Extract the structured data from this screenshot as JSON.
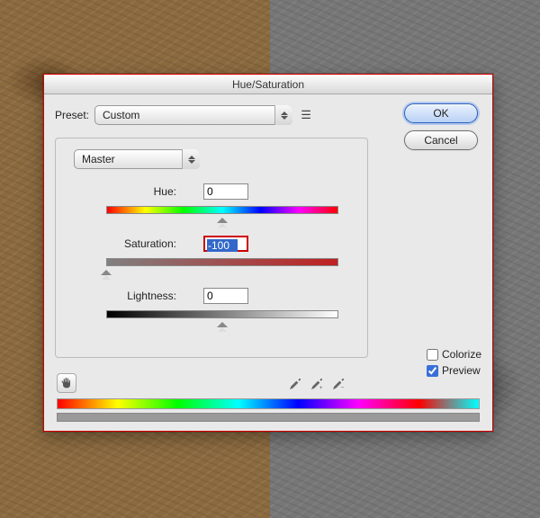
{
  "dialog": {
    "title": "Hue/Saturation",
    "preset_label": "Preset:",
    "preset_value": "Custom",
    "channel_value": "Master",
    "buttons": {
      "ok": "OK",
      "cancel": "Cancel"
    },
    "params": {
      "hue": {
        "label": "Hue:",
        "value": "0",
        "handle": 0.5
      },
      "saturation": {
        "label": "Saturation:",
        "value": "-100",
        "handle": 0.0
      },
      "lightness": {
        "label": "Lightness:",
        "value": "0",
        "handle": 0.5
      }
    },
    "checks": {
      "colorize": {
        "label": "Colorize",
        "checked": false
      },
      "preview": {
        "label": "Preview",
        "checked": true
      }
    }
  }
}
